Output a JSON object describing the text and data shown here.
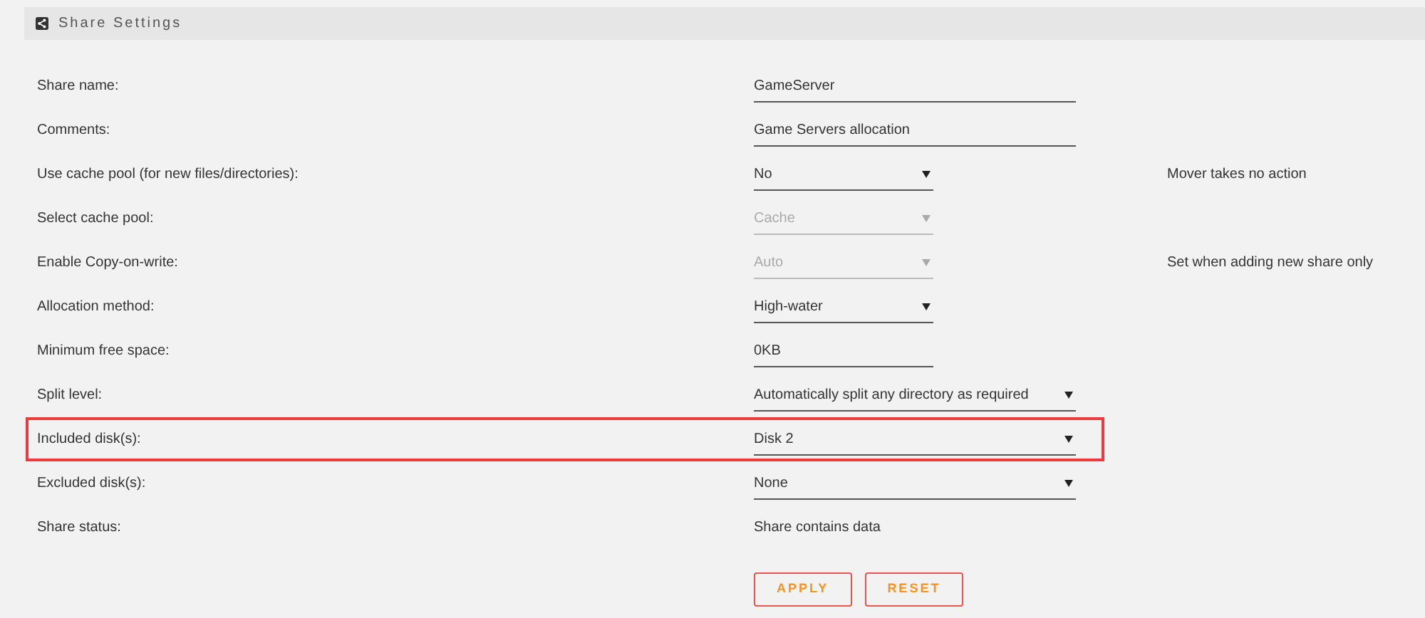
{
  "panel": {
    "title": "Share Settings"
  },
  "rows": [
    {
      "label": "Share name:",
      "kind": "text",
      "value": "GameServer",
      "disabled": false,
      "highlighted": false
    },
    {
      "label": "Comments:",
      "kind": "text",
      "value": "Game Servers allocation",
      "disabled": false,
      "highlighted": false
    },
    {
      "label": "Use cache pool (for new files/directories):",
      "kind": "select",
      "value": "No",
      "disabled": false,
      "highlighted": false,
      "note": "Mover takes no action"
    },
    {
      "label": "Select cache pool:",
      "kind": "select",
      "value": "Cache",
      "disabled": true,
      "highlighted": false
    },
    {
      "label": "Enable Copy-on-write:",
      "kind": "select",
      "value": "Auto",
      "disabled": true,
      "highlighted": false,
      "note": "Set when adding new share only"
    },
    {
      "label": "Allocation method:",
      "kind": "select",
      "value": "High-water",
      "disabled": false,
      "highlighted": false
    },
    {
      "label": "Minimum free space:",
      "kind": "text",
      "value": "0KB",
      "disabled": false,
      "highlighted": false
    },
    {
      "label": "Split level:",
      "kind": "select",
      "value": "Automatically split any directory as required",
      "disabled": false,
      "highlighted": false
    },
    {
      "label": "Included disk(s):",
      "kind": "select",
      "value": "Disk 2",
      "disabled": false,
      "highlighted": true
    },
    {
      "label": "Excluded disk(s):",
      "kind": "select",
      "value": "None",
      "disabled": false,
      "highlighted": false
    },
    {
      "label": "Share status:",
      "kind": "static",
      "value": "Share contains data",
      "highlighted": false
    }
  ],
  "buttons": [
    "APPLY",
    "RESET"
  ]
}
